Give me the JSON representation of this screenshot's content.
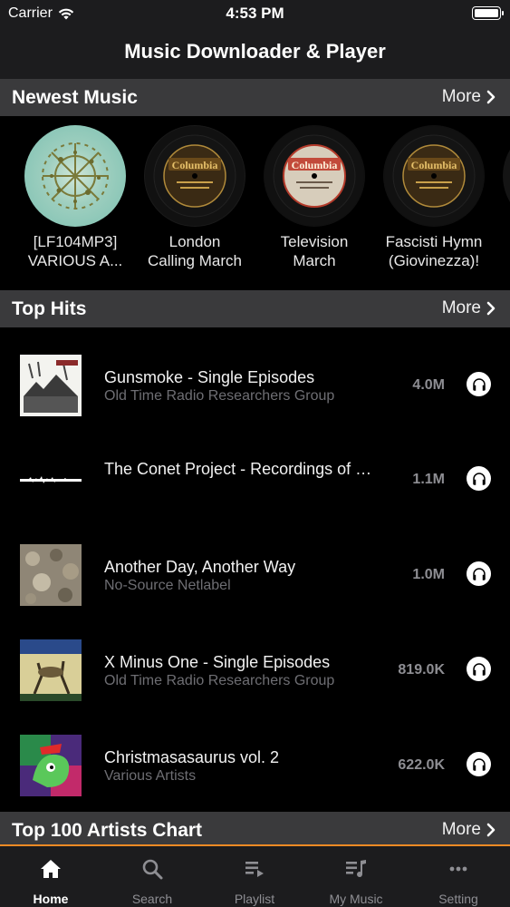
{
  "status_bar": {
    "carrier": "Carrier",
    "time": "4:53 PM"
  },
  "nav": {
    "title": "Music Downloader & Player"
  },
  "sections": {
    "newest": {
      "title": "Newest Music",
      "more": "More"
    },
    "top_hits": {
      "title": "Top Hits",
      "more": "More"
    },
    "top_artists": {
      "title": "Top 100 Artists Chart",
      "more": "More"
    }
  },
  "newest_music": [
    {
      "line1": "[LF104MP3]",
      "line2": "VARIOUS A...",
      "label": ""
    },
    {
      "line1": "London",
      "line2": "Calling March",
      "label": "Columbia"
    },
    {
      "line1": "Television",
      "line2": "March",
      "label": "Columbia"
    },
    {
      "line1": "Fascisti Hymn",
      "line2": "(Giovinezza)!",
      "label": "Columbia"
    }
  ],
  "top_hits": [
    {
      "title": "Gunsmoke - Single Episodes",
      "subtitle": "Old Time Radio Researchers Group",
      "size": "4.0M"
    },
    {
      "title": "The Conet Project - Recordings of Shortwave Numbers Stations...",
      "subtitle": "",
      "size": "1.1M"
    },
    {
      "title": "Another Day, Another Way",
      "subtitle": "No-Source Netlabel",
      "size": "1.0M"
    },
    {
      "title": "X Minus One - Single Episodes",
      "subtitle": "Old Time Radio Researchers Group",
      "size": "819.0K"
    },
    {
      "title": "Christmasasaurus vol. 2",
      "subtitle": "Various Artists",
      "size": "622.0K"
    }
  ],
  "tabs": [
    {
      "label": "Home",
      "icon": "home-icon",
      "active": true
    },
    {
      "label": "Search",
      "icon": "search-icon",
      "active": false
    },
    {
      "label": "Playlist",
      "icon": "playlist-icon",
      "active": false
    },
    {
      "label": "My Music",
      "icon": "my-music-icon",
      "active": false
    },
    {
      "label": "Setting",
      "icon": "more-icon",
      "active": false
    }
  ],
  "colors": {
    "background": "#000000",
    "header_bg": "#3a3a3c",
    "bar_bg": "#1c1c1e",
    "accent": "#f08a24",
    "secondary_text": "#6e6e73"
  }
}
